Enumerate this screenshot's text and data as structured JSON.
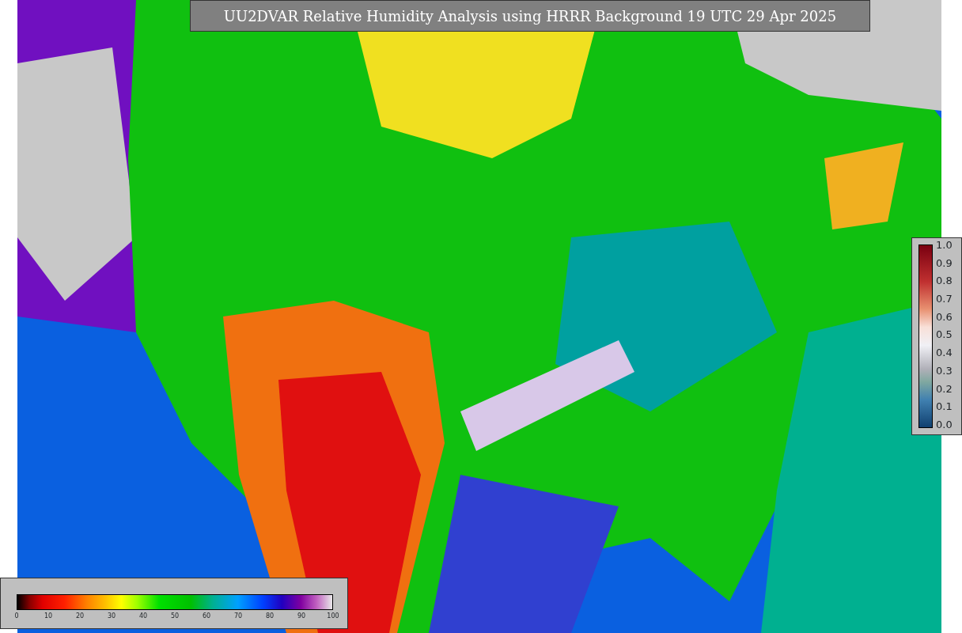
{
  "title": "UU2DVAR Relative Humidity Analysis using HRRR Background 19 UTC 29 Apr 2025",
  "humidity_scale": {
    "ticks": [
      "0",
      "10",
      "20",
      "30",
      "40",
      "50",
      "60",
      "70",
      "80",
      "90",
      "100"
    ]
  },
  "weight_scale": {
    "ticks": [
      "1.0",
      "0.9",
      "0.8",
      "0.7",
      "0.6",
      "0.5",
      "0.4",
      "0.3",
      "0.2",
      "0.1",
      "0.0"
    ]
  }
}
